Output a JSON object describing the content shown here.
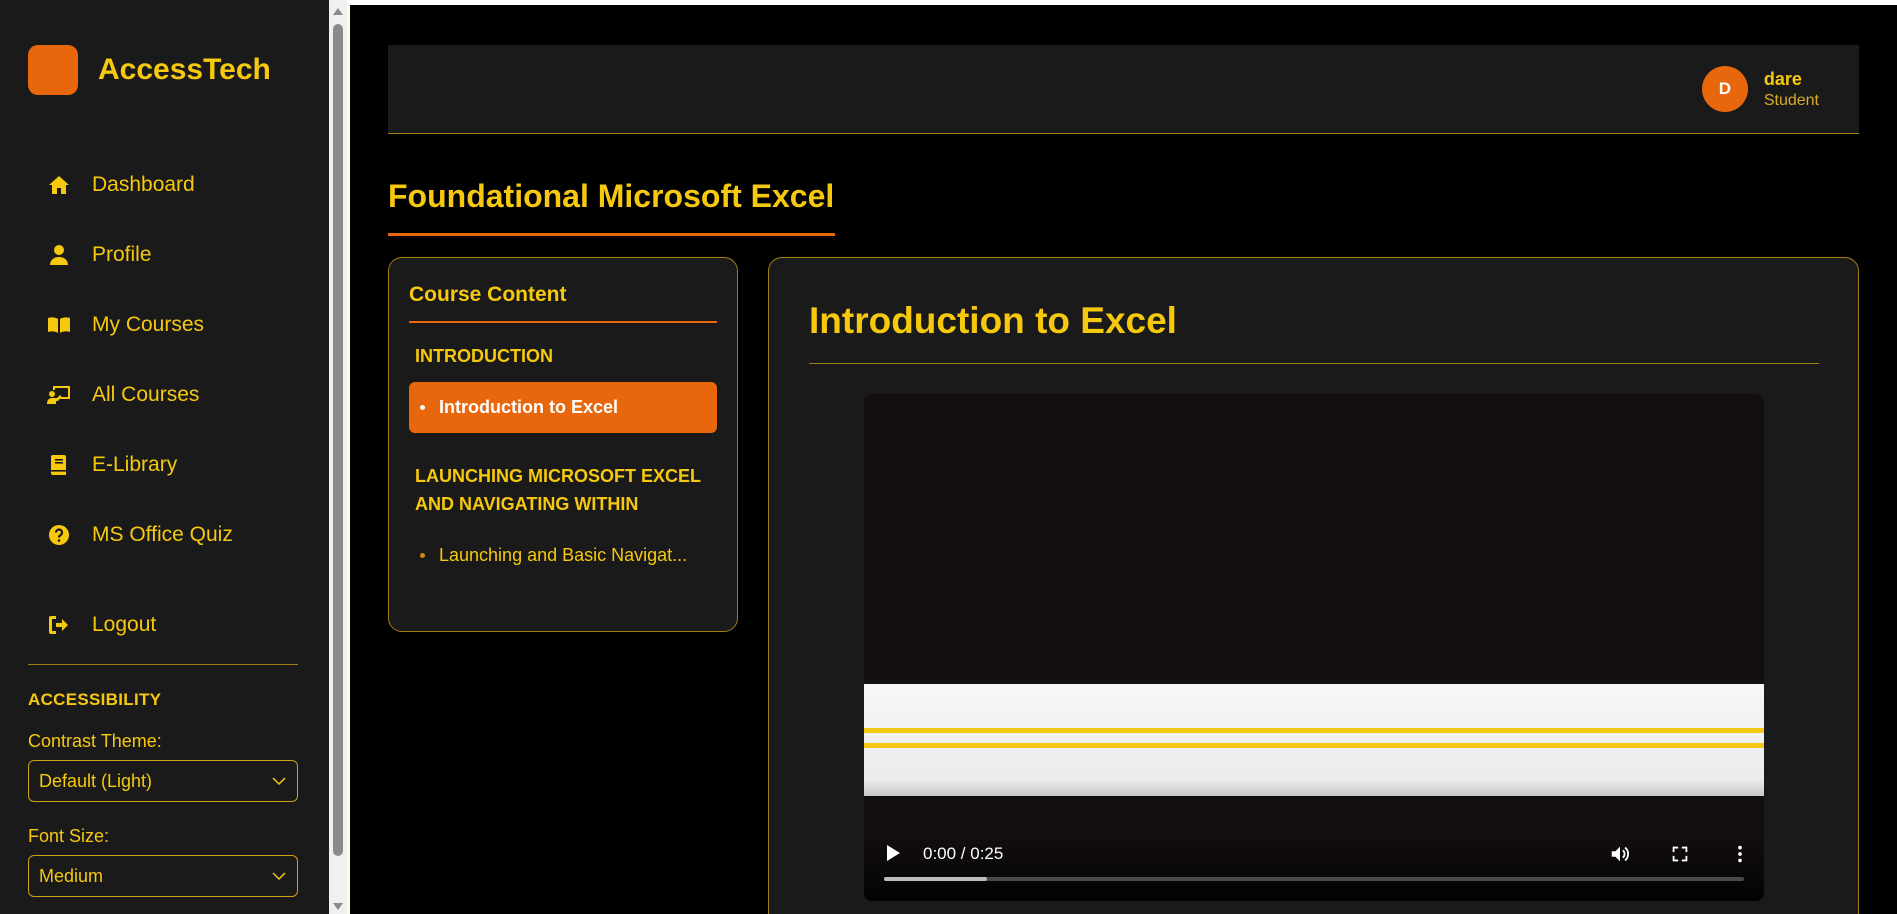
{
  "app": {
    "brand": "AccessTech"
  },
  "sidebar": {
    "items": [
      {
        "label": "Dashboard",
        "icon": "home-icon"
      },
      {
        "label": "Profile",
        "icon": "user-icon"
      },
      {
        "label": "My Courses",
        "icon": "book-open-icon"
      },
      {
        "label": "All Courses",
        "icon": "chalkboard-teacher-icon"
      },
      {
        "label": "E-Library",
        "icon": "book-icon"
      },
      {
        "label": "MS Office Quiz",
        "icon": "question-circle-icon"
      }
    ],
    "logout": {
      "label": "Logout",
      "icon": "sign-out-icon"
    },
    "accessibility": {
      "title": "ACCESSIBILITY",
      "contrast_label": "Contrast Theme:",
      "contrast_value": "Default (Light)",
      "font_label": "Font Size:",
      "font_value": "Medium"
    }
  },
  "header": {
    "user": {
      "initial": "D",
      "name": "dare",
      "role": "Student"
    }
  },
  "page": {
    "title": "Foundational Microsoft Excel"
  },
  "course_content": {
    "title": "Course Content",
    "sections": [
      {
        "title": "INTRODUCTION",
        "lessons": [
          {
            "label": "Introduction to Excel",
            "active": true
          }
        ]
      },
      {
        "title": "LAUNCHING MICROSOFT EXCEL AND NAVIGATING WITHIN",
        "lessons": [
          {
            "label": "Launching and Basic Navigat...",
            "active": false
          }
        ]
      }
    ]
  },
  "lesson": {
    "title": "Introduction to Excel",
    "video": {
      "time": "0:00 / 0:25",
      "progress": 0.12
    }
  },
  "colors": {
    "accent": "#f6c90e",
    "brand": "#e8670c",
    "panel": "#1a1a1a",
    "background": "#000000"
  }
}
